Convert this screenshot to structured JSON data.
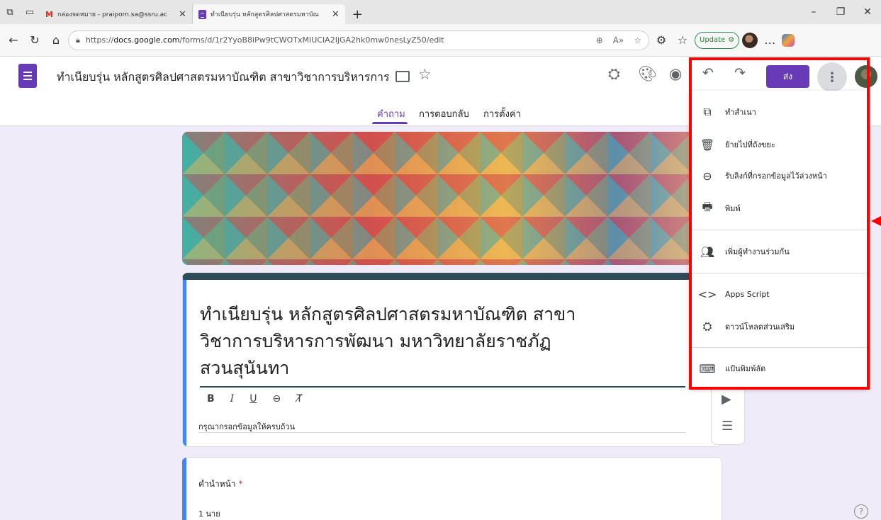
{
  "browser": {
    "tabs": [
      {
        "title": "กล่องจดหมาย - praiporn.sa@ssru.ac",
        "icon": "gmail-icon"
      },
      {
        "title": "ทำเนียบรุ่น หลักสูตรศิลปศาสตรมหาบัณ",
        "icon": "google-forms-icon"
      }
    ],
    "new_tab": "+",
    "url_prefix": "https://",
    "url_host": "docs.google.com",
    "url_path": "/forms/d/1r2YyoB8iPw9tCWOTxMIUCIA2IjGA2hk0mw0nesLyZ50/edit",
    "update_label": "Update"
  },
  "form": {
    "header_title": "ทำเนียบรุ่น หลักสูตรศิลปศาสตรมหาบัณฑิต สาขาวิชาการบริหารการพัฒนา มห",
    "tabs": [
      "คำถาม",
      "การตอบกลับ",
      "การตั้งค่า"
    ],
    "send_label": "ส่ง",
    "title": "ทำเนียบรุ่น หลักสูตรศิลปศาสตรมหาบัณฑิต สาขาวิชาการบริหารการพัฒนา มหาวิทยาลัยราชภัฏสวนสุนันทา",
    "title_line1": "ทำเนียบรุ่น หลักสูตรศิลปศาสตรมหาบัณฑิต สาขา",
    "title_line2": "วิชาการบริหารการพัฒนา มหาวิทยาลัยราชภัฏ",
    "title_line3": "สวนสุนันทา",
    "description": "กรุณากรอกข้อมูลให้ครบถ้วน",
    "question_label": "คำนำหน้า",
    "required_mark": "*",
    "option_1": "1  นาย"
  },
  "menu": {
    "items": [
      {
        "label": "ทำสำเนา",
        "icon": "copy-icon"
      },
      {
        "label": "ย้ายไปที่ถังขยะ",
        "icon": "trash-icon"
      },
      {
        "label": "รับลิงก์ที่กรอกข้อมูลไว้ล่วงหน้า",
        "icon": "link-icon"
      },
      {
        "label": "พิมพ์",
        "icon": "print-icon"
      },
      {
        "label": "เพิ่มผู้ทำงานร่วมกัน",
        "icon": "add-people-icon"
      },
      {
        "label": "Apps Script",
        "icon": "code-icon"
      },
      {
        "label": "ดาวน์โหลดส่วนเสริม",
        "icon": "addon-icon"
      },
      {
        "label": "แป้นพิมพ์ลัด",
        "icon": "keyboard-icon"
      }
    ]
  },
  "colors": {
    "accent": "#673ab7",
    "annotation": "#ff0000",
    "title_bar": "#2d4c58",
    "question_bar": "#4285f4"
  }
}
